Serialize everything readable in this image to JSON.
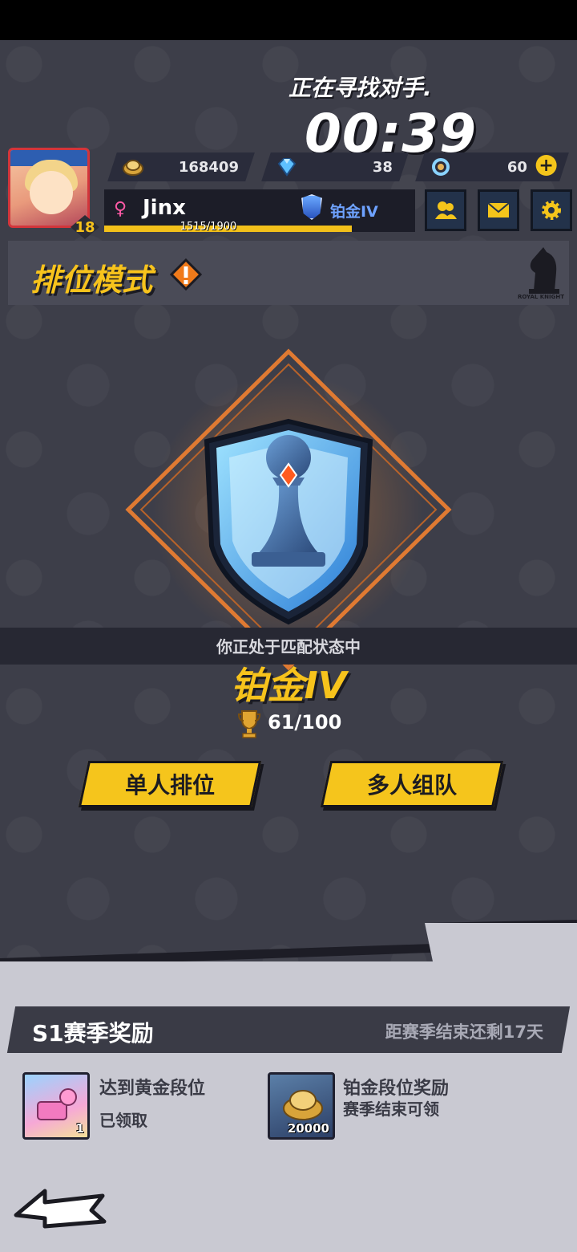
{
  "status": {
    "searching": "正在寻找对手.",
    "timer": "00:39"
  },
  "player": {
    "level": "18",
    "name": "Jinx",
    "rank": "铂金IV",
    "xp_text": "1515/1900",
    "xp_progress": 0.797
  },
  "resources": [
    {
      "icon": "gold-coin-icon",
      "value": "168409"
    },
    {
      "icon": "diamond-icon",
      "value": "38"
    },
    {
      "icon": "energy-ring-icon",
      "value": "60"
    }
  ],
  "top_buttons": [
    "friends-icon",
    "mail-icon",
    "settings-gear-icon"
  ],
  "mode": {
    "title": "排位模式",
    "logo_text": "ROYAL KNIGHT"
  },
  "match": {
    "status_text": "你正处于匹配状态中",
    "rank_name": "铂金IV",
    "points": "61/100"
  },
  "buttons": {
    "solo": "单人排位",
    "team": "多人组队"
  },
  "season": {
    "title": "S1赛季奖励",
    "remaining": "距赛季结束还剩17天",
    "rewards": [
      {
        "title": "达到黄金段位",
        "sub": "已领取",
        "qty": "1"
      },
      {
        "title": "铂金段位奖励",
        "sub": "赛季结束可领",
        "qty": "20000"
      }
    ]
  },
  "colors": {
    "accent": "#f5c51c",
    "background": "#3d3e49",
    "rank_blue": "#6ea2ff"
  }
}
